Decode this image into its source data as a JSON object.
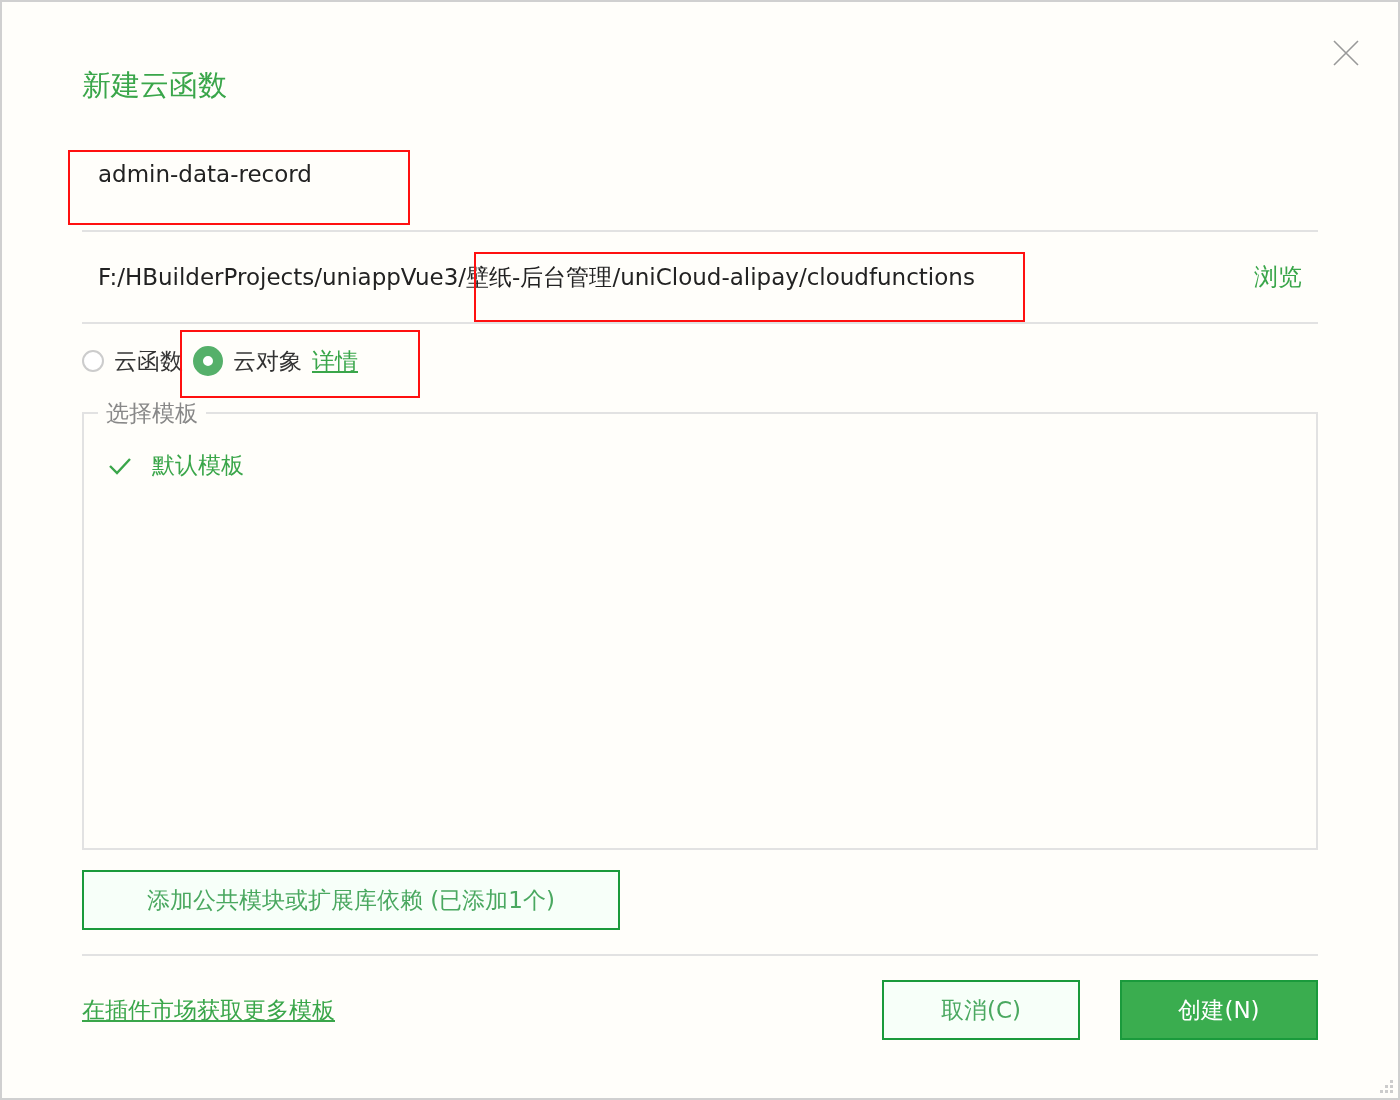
{
  "dialog": {
    "title": "新建云函数"
  },
  "name_field": {
    "value": "admin-data-record"
  },
  "path_field": {
    "value": "F:/HBuilderProjects/uniappVue3/壁纸-后台管理/uniCloud-alipay/cloudfunctions",
    "browse": "浏览"
  },
  "type_radios": [
    {
      "label": "云函数",
      "selected": false
    },
    {
      "label": "云对象",
      "selected": true
    }
  ],
  "details_link": "详情",
  "templates": {
    "legend": "选择模板",
    "items": [
      {
        "label": "默认模板",
        "selected": true
      }
    ]
  },
  "dependency_button": "添加公共模块或扩展库依赖 (已添加1个)",
  "market_link": "在插件市场获取更多模板",
  "buttons": [
    {
      "label": "取消(C)",
      "kind": "secondary"
    },
    {
      "label": "创建(N)",
      "kind": "primary"
    }
  ]
}
